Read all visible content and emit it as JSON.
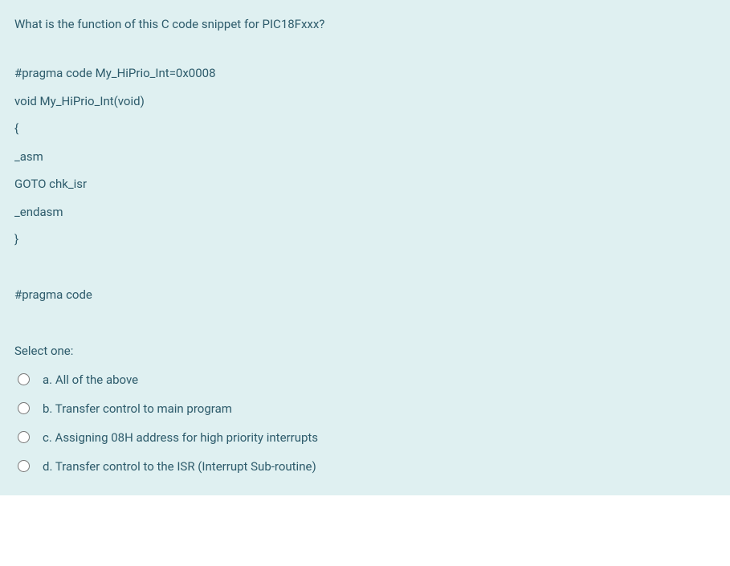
{
  "question": {
    "prompt": "What is the function of this C code snippet for PIC18Fxxx?",
    "code_lines": [
      "#pragma code My_HiPrio_Int=0x0008",
      "void My_HiPrio_Int(void)",
      "{",
      "_asm",
      "GOTO chk_isr",
      "_endasm",
      "}",
      "",
      "#pragma code"
    ],
    "select_label": "Select one:",
    "options": [
      {
        "label": "a. All of the above"
      },
      {
        "label": "b. Transfer control to main program"
      },
      {
        "label": "c. Assigning 08H address for high priority interrupts"
      },
      {
        "label": "d. Transfer control to the ISR (Interrupt Sub-routine)"
      }
    ]
  }
}
